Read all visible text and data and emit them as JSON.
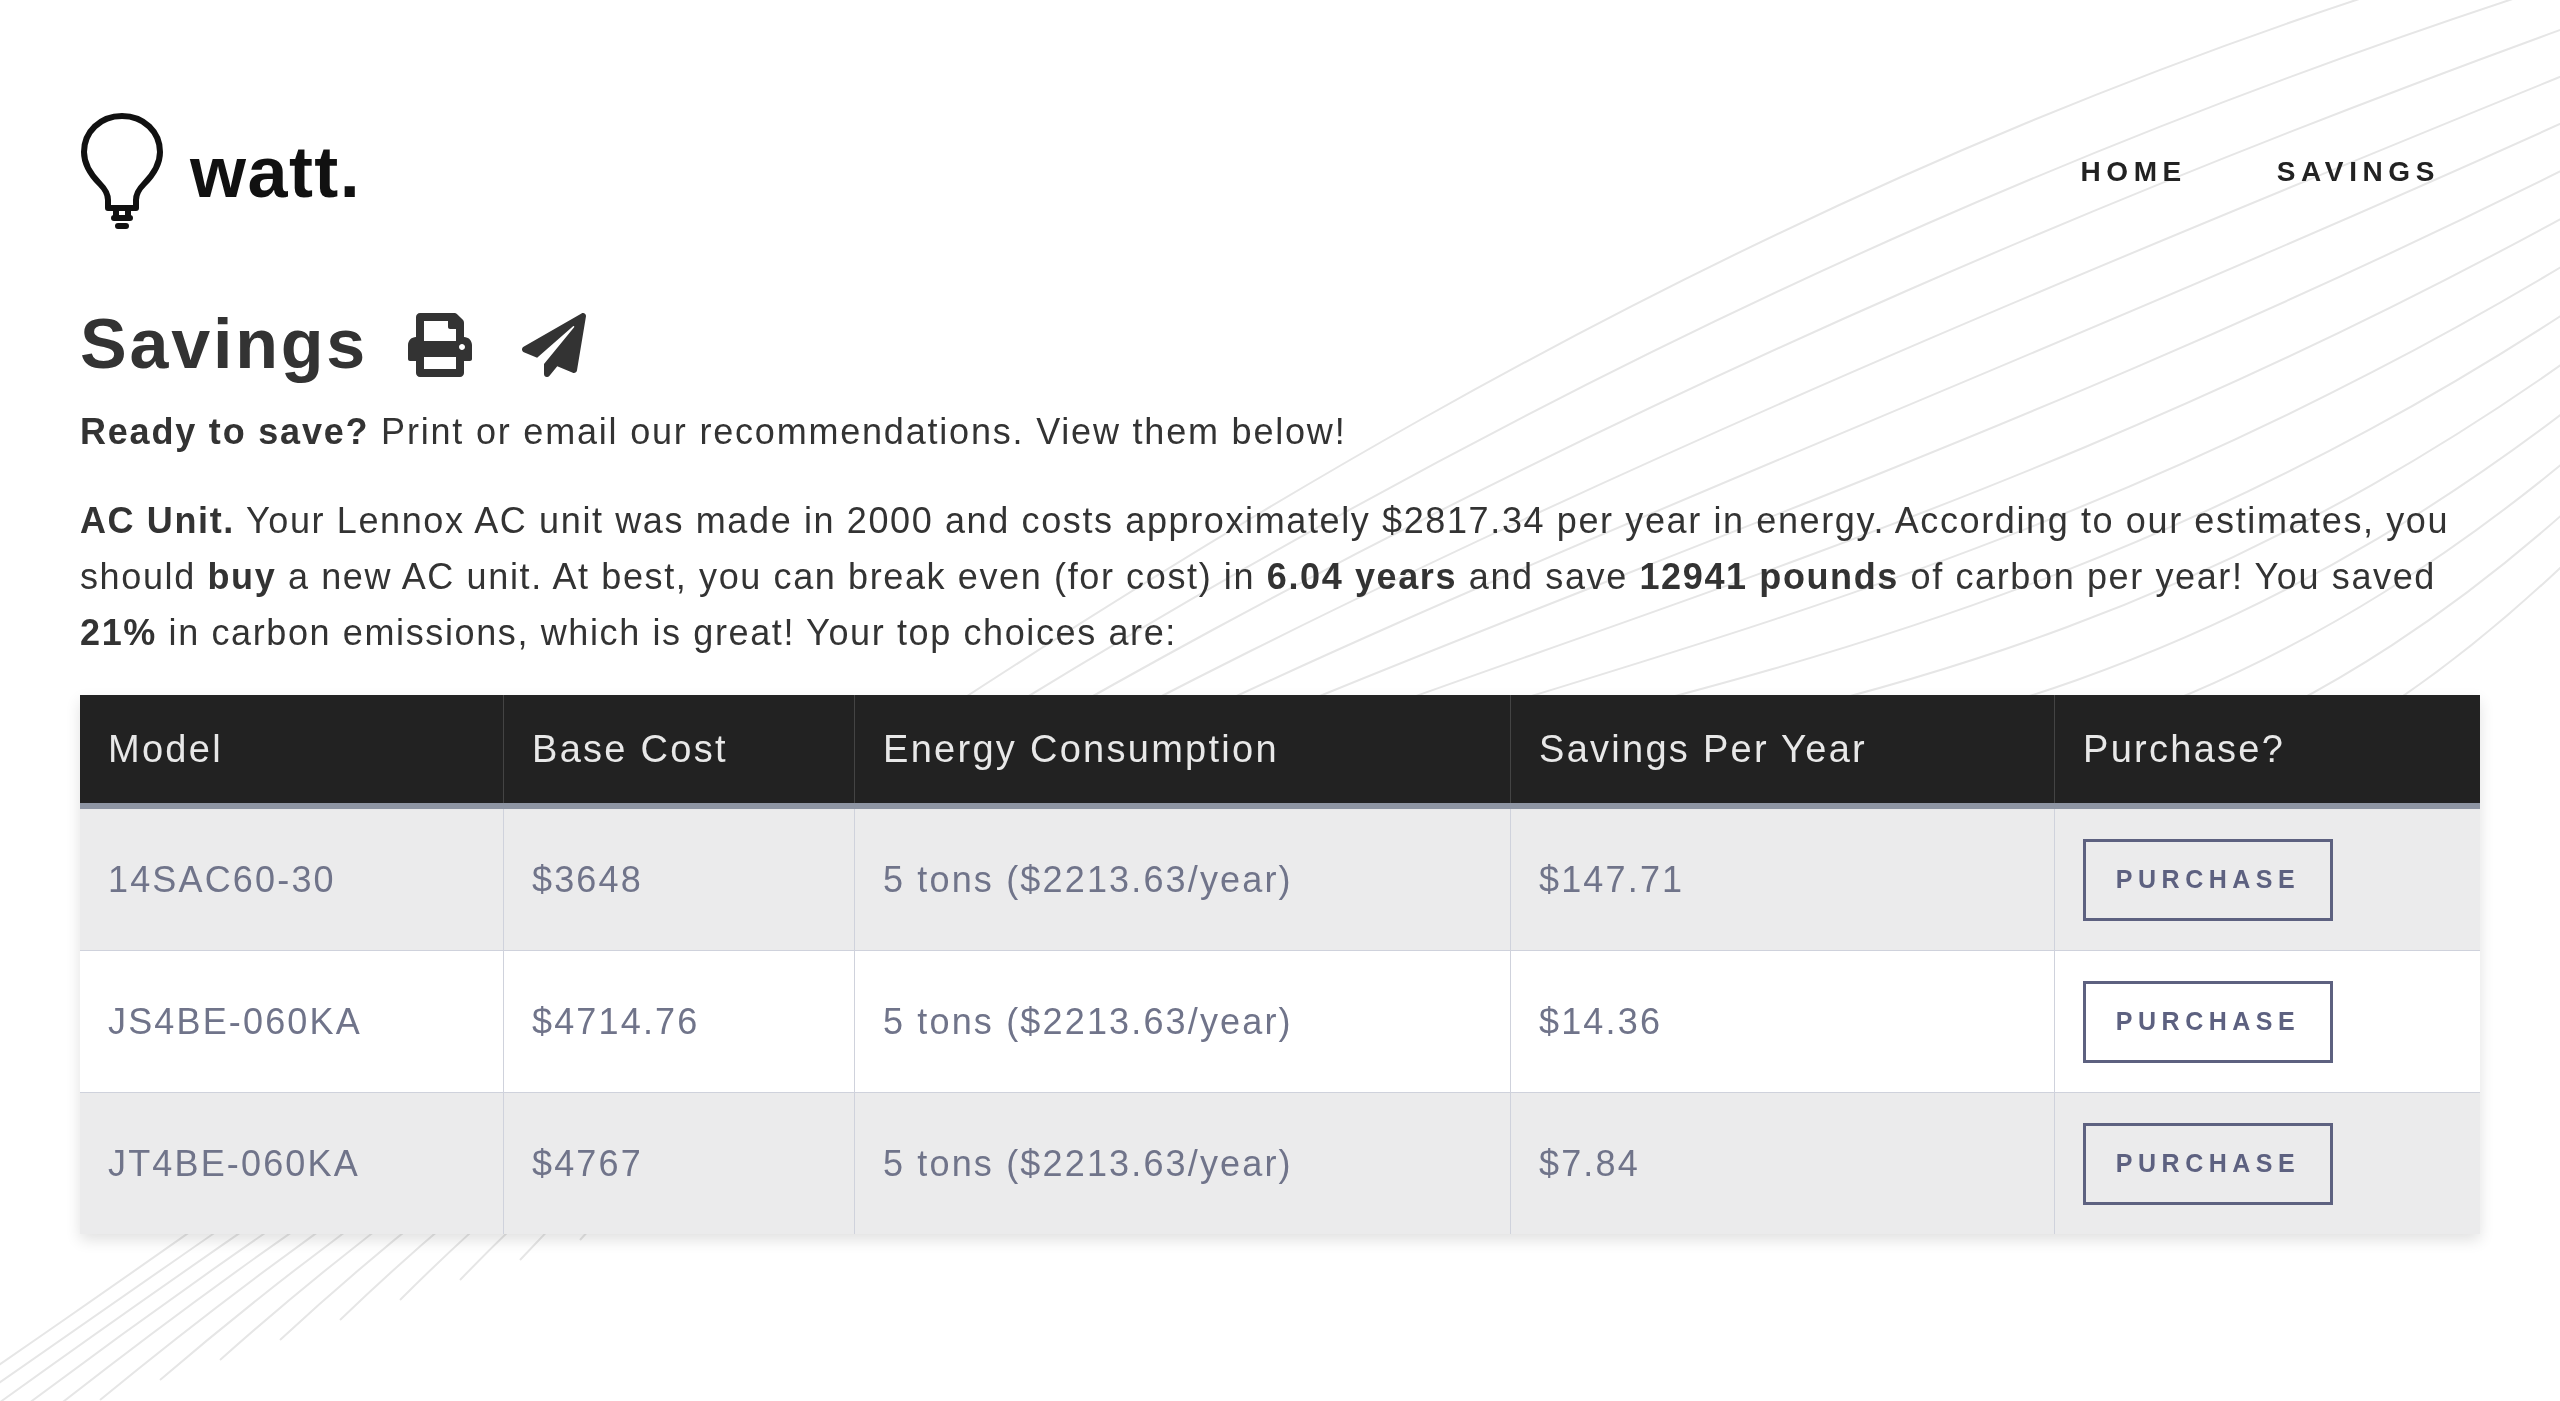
{
  "logo": {
    "text": "watt."
  },
  "nav": [
    {
      "label": "HOME"
    },
    {
      "label": "SAVINGS"
    }
  ],
  "page_title": "Savings",
  "intro": "**Ready to save?** Print or email our recommendations. View them below!",
  "summary": "**AC Unit.** Your Lennox AC unit was made in 2000 and costs approximately $2817.34 per year in energy. According to our estimates, you should **buy** a new AC unit. At best, you can break even (for cost) in **6.04 years** and save **12941 pounds** of carbon per year! You saved **21%** in carbon emissions, which is great! Your top choices are:",
  "table": {
    "columns": [
      "Model",
      "Base Cost",
      "Energy Consumption",
      "Savings Per Year",
      "Purchase?"
    ],
    "rows": [
      {
        "model": "14SAC60-30",
        "base_cost": "$3648",
        "energy": "5 tons ($2213.63/year)",
        "savings": "$147.71",
        "action": "PURCHASE"
      },
      {
        "model": "JS4BE-060KA",
        "base_cost": "$4714.76",
        "energy": "5 tons ($2213.63/year)",
        "savings": "$14.36",
        "action": "PURCHASE"
      },
      {
        "model": "JT4BE-060KA",
        "base_cost": "$4767",
        "energy": "5 tons ($2213.63/year)",
        "savings": "$7.84",
        "action": "PURCHASE"
      }
    ]
  }
}
